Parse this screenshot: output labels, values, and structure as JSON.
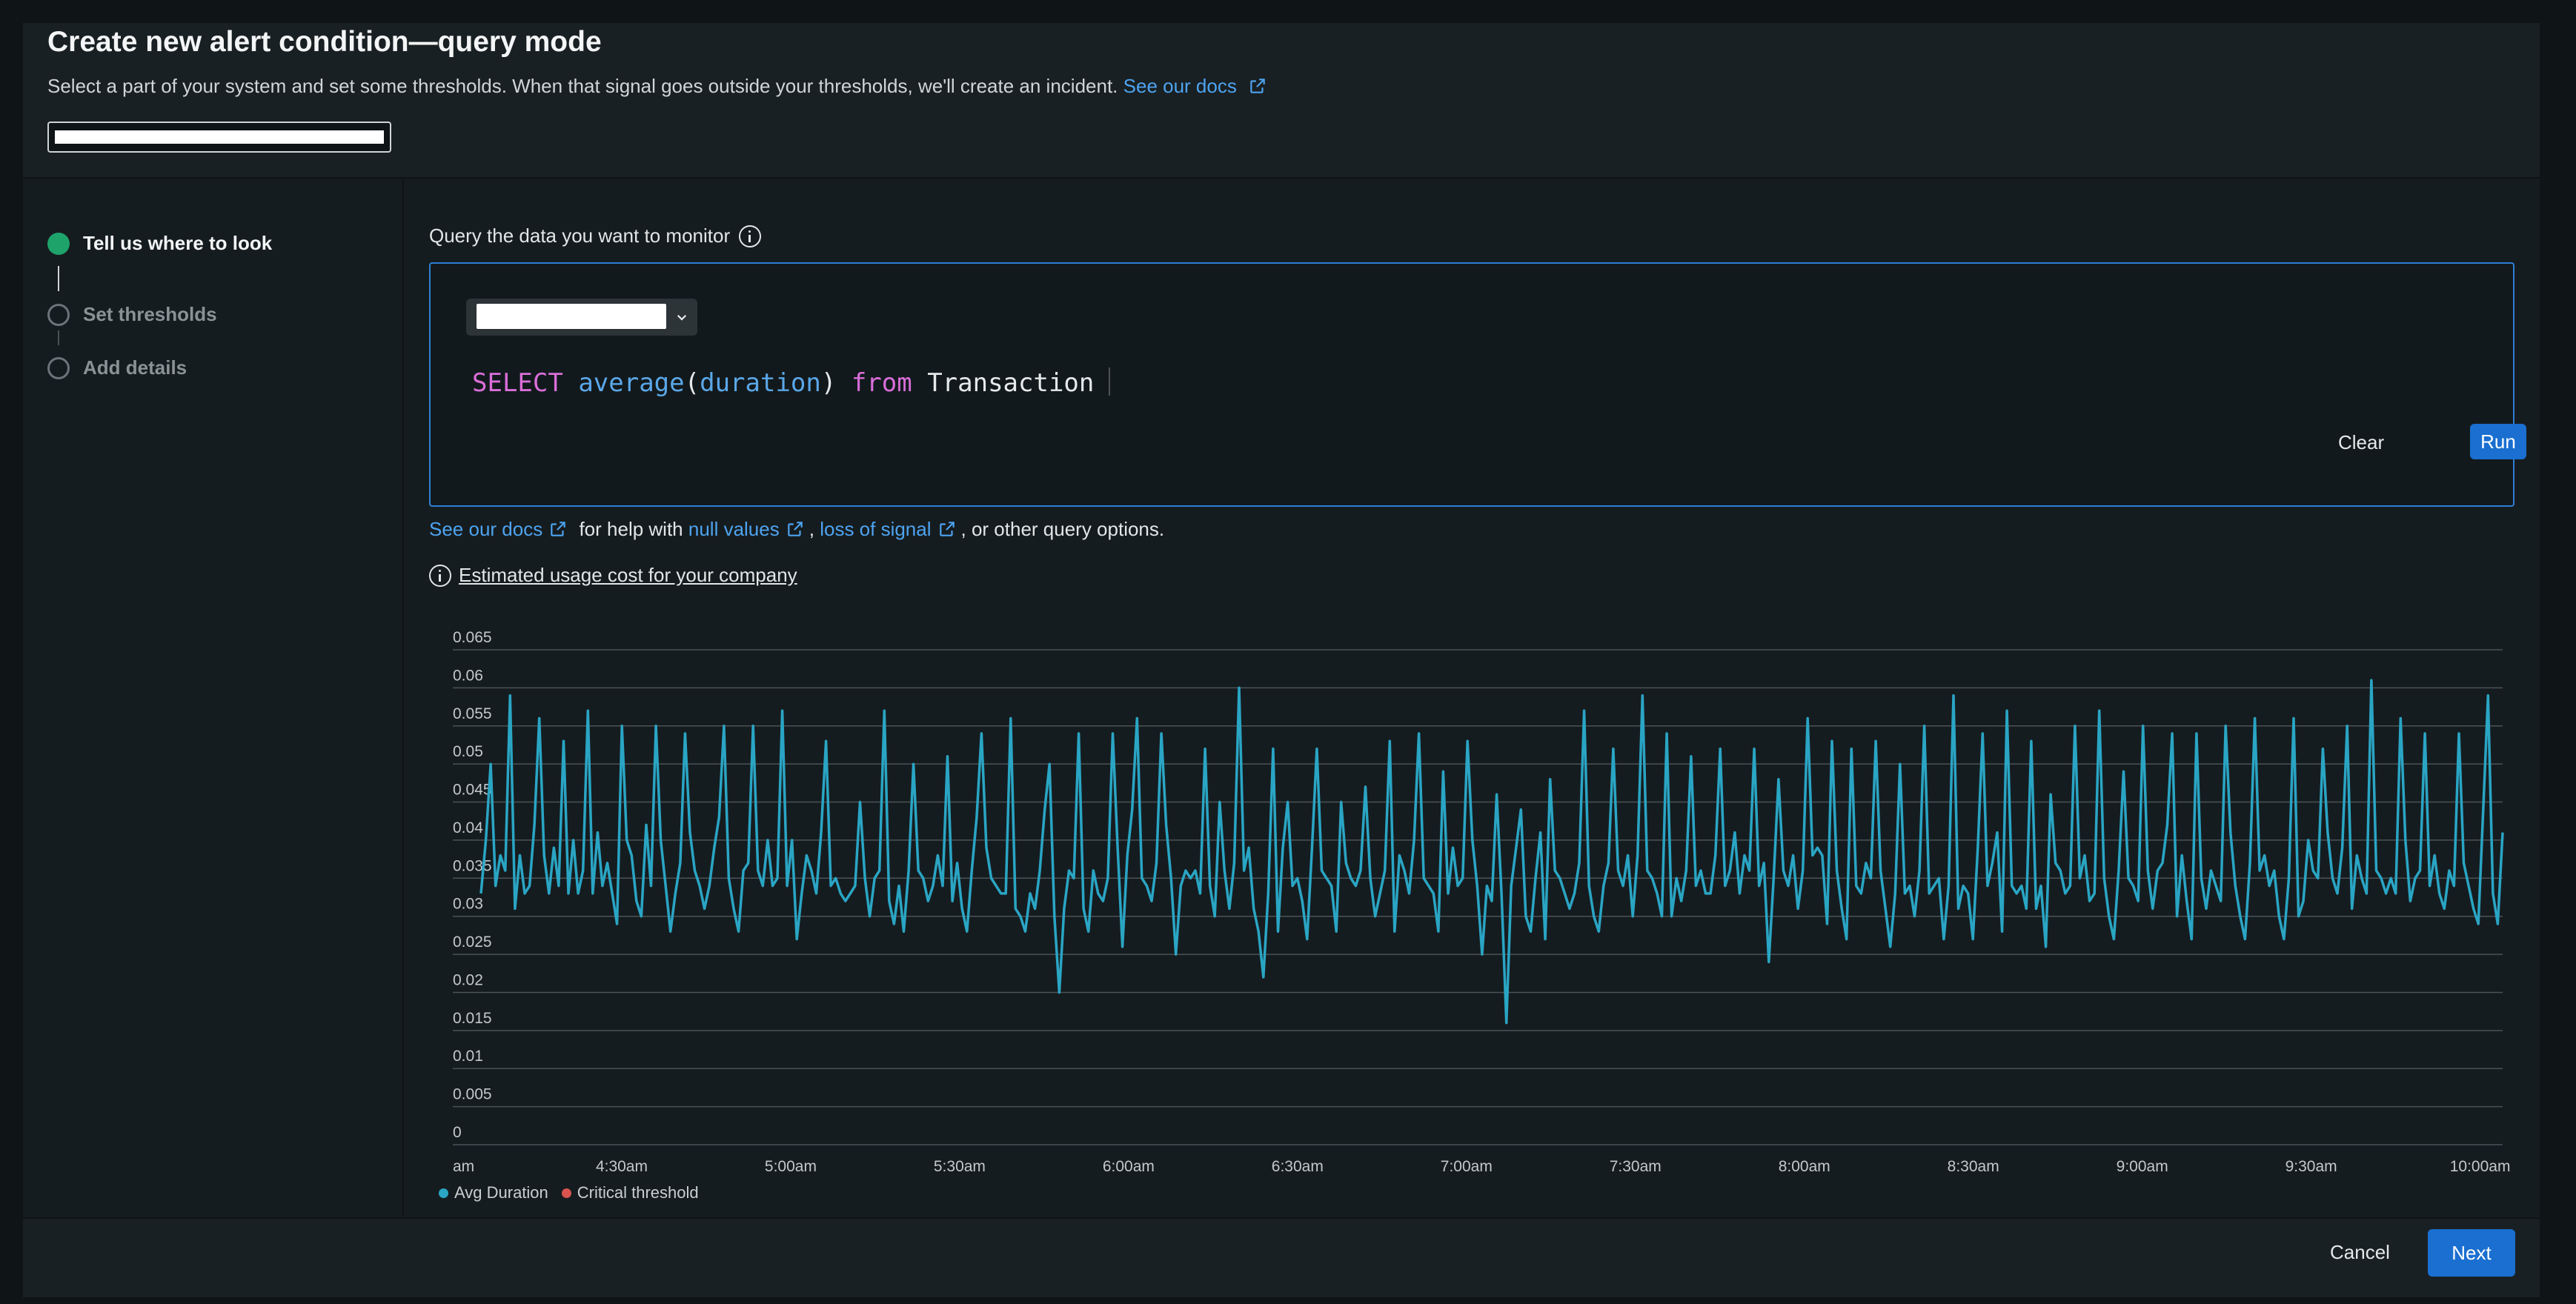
{
  "header": {
    "title": "Create new alert condition—query mode",
    "subtitle": "Select a part of your system and set some thresholds. When that signal goes outside your thresholds, we'll create an incident.",
    "docs_link": "See our docs"
  },
  "steps": [
    {
      "label": "Tell us where to look",
      "state": "done"
    },
    {
      "label": "Set thresholds",
      "state": "todo"
    },
    {
      "label": "Add details",
      "state": "todo"
    }
  ],
  "query": {
    "label": "Query the data you want to monitor",
    "tokens": {
      "select": "SELECT",
      "func": "average",
      "open": "(",
      "arg": "duration",
      "close": ")",
      "from": "from",
      "table": "Transaction"
    },
    "clear_label": "Clear",
    "run_label": "Run"
  },
  "help": {
    "docs": "See our docs",
    "mid1": "for help with",
    "null_values": "null values",
    "comma": ",",
    "loss_of_signal": "loss of signal",
    "tail": ", or other query options."
  },
  "estimate": {
    "label": "Estimated usage cost for your company"
  },
  "chart_data": {
    "type": "line",
    "y_ticks": [
      "0",
      "0.005",
      "0.01",
      "0.015",
      "0.02",
      "0.025",
      "0.03",
      "0.035",
      "0.04",
      "0.045",
      "0.05",
      "0.055",
      "0.06",
      "0.065"
    ],
    "ylim": [
      0,
      0.065
    ],
    "x_ticks": [
      "am",
      "4:30am",
      "5:00am",
      "5:30am",
      "6:00am",
      "6:30am",
      "7:00am",
      "7:30am",
      "8:00am",
      "8:30am",
      "9:00am",
      "9:30am",
      "10:00am"
    ],
    "xlim": [
      "4:00am",
      "10:04am"
    ],
    "grid": true,
    "legend_position": "bottom-left",
    "series": [
      {
        "name": "Avg Duration",
        "color": "#2aa5c4",
        "x_start": "4:05am",
        "x_step_minutes": 1,
        "values": [
          0.033,
          0.04,
          0.05,
          0.034,
          0.038,
          0.036,
          0.059,
          0.031,
          0.038,
          0.033,
          0.034,
          0.042,
          0.056,
          0.038,
          0.033,
          0.039,
          0.034,
          0.053,
          0.033,
          0.04,
          0.033,
          0.036,
          0.057,
          0.033,
          0.041,
          0.034,
          0.037,
          0.033,
          0.029,
          0.055,
          0.04,
          0.038,
          0.032,
          0.03,
          0.042,
          0.034,
          0.055,
          0.04,
          0.034,
          0.028,
          0.033,
          0.037,
          0.054,
          0.041,
          0.036,
          0.034,
          0.031,
          0.034,
          0.039,
          0.043,
          0.055,
          0.035,
          0.031,
          0.028,
          0.036,
          0.037,
          0.055,
          0.036,
          0.034,
          0.04,
          0.034,
          0.035,
          0.057,
          0.034,
          0.04,
          0.027,
          0.033,
          0.038,
          0.036,
          0.033,
          0.041,
          0.053,
          0.034,
          0.035,
          0.033,
          0.032,
          0.033,
          0.034,
          0.045,
          0.035,
          0.03,
          0.035,
          0.036,
          0.057,
          0.032,
          0.029,
          0.034,
          0.028,
          0.036,
          0.05,
          0.036,
          0.035,
          0.032,
          0.034,
          0.038,
          0.034,
          0.051,
          0.032,
          0.037,
          0.031,
          0.028,
          0.036,
          0.043,
          0.054,
          0.039,
          0.035,
          0.034,
          0.033,
          0.033,
          0.056,
          0.031,
          0.03,
          0.028,
          0.033,
          0.031,
          0.036,
          0.044,
          0.05,
          0.03,
          0.02,
          0.031,
          0.036,
          0.035,
          0.054,
          0.031,
          0.028,
          0.036,
          0.033,
          0.032,
          0.035,
          0.054,
          0.039,
          0.026,
          0.038,
          0.044,
          0.056,
          0.035,
          0.034,
          0.032,
          0.037,
          0.054,
          0.042,
          0.035,
          0.025,
          0.034,
          0.036,
          0.035,
          0.036,
          0.033,
          0.052,
          0.034,
          0.03,
          0.045,
          0.036,
          0.031,
          0.037,
          0.06,
          0.036,
          0.039,
          0.031,
          0.028,
          0.022,
          0.033,
          0.052,
          0.028,
          0.039,
          0.045,
          0.034,
          0.035,
          0.032,
          0.027,
          0.039,
          0.052,
          0.036,
          0.035,
          0.034,
          0.028,
          0.045,
          0.037,
          0.035,
          0.034,
          0.036,
          0.047,
          0.035,
          0.03,
          0.033,
          0.036,
          0.053,
          0.028,
          0.038,
          0.036,
          0.033,
          0.04,
          0.054,
          0.035,
          0.034,
          0.033,
          0.028,
          0.049,
          0.033,
          0.039,
          0.034,
          0.035,
          0.053,
          0.04,
          0.034,
          0.025,
          0.034,
          0.032,
          0.046,
          0.033,
          0.016,
          0.034,
          0.039,
          0.044,
          0.03,
          0.028,
          0.035,
          0.041,
          0.027,
          0.048,
          0.036,
          0.035,
          0.033,
          0.031,
          0.033,
          0.037,
          0.057,
          0.034,
          0.03,
          0.028,
          0.034,
          0.037,
          0.052,
          0.036,
          0.034,
          0.038,
          0.03,
          0.038,
          0.059,
          0.036,
          0.035,
          0.033,
          0.03,
          0.054,
          0.03,
          0.035,
          0.032,
          0.036,
          0.051,
          0.034,
          0.036,
          0.033,
          0.033,
          0.038,
          0.052,
          0.034,
          0.036,
          0.041,
          0.033,
          0.038,
          0.036,
          0.052,
          0.034,
          0.037,
          0.024,
          0.035,
          0.048,
          0.036,
          0.034,
          0.038,
          0.031,
          0.036,
          0.056,
          0.038,
          0.039,
          0.038,
          0.029,
          0.053,
          0.036,
          0.031,
          0.027,
          0.052,
          0.034,
          0.033,
          0.037,
          0.035,
          0.053,
          0.036,
          0.031,
          0.026,
          0.033,
          0.05,
          0.033,
          0.034,
          0.03,
          0.036,
          0.055,
          0.033,
          0.034,
          0.035,
          0.027,
          0.034,
          0.059,
          0.031,
          0.034,
          0.033,
          0.027,
          0.039,
          0.054,
          0.034,
          0.037,
          0.041,
          0.028,
          0.057,
          0.034,
          0.033,
          0.034,
          0.031,
          0.053,
          0.031,
          0.034,
          0.026,
          0.046,
          0.037,
          0.036,
          0.033,
          0.034,
          0.055,
          0.035,
          0.038,
          0.032,
          0.033,
          0.057,
          0.035,
          0.03,
          0.027,
          0.036,
          0.049,
          0.035,
          0.034,
          0.032,
          0.055,
          0.036,
          0.031,
          0.036,
          0.037,
          0.042,
          0.054,
          0.03,
          0.038,
          0.032,
          0.027,
          0.054,
          0.035,
          0.031,
          0.036,
          0.034,
          0.032,
          0.055,
          0.041,
          0.034,
          0.03,
          0.027,
          0.037,
          0.056,
          0.036,
          0.038,
          0.034,
          0.036,
          0.03,
          0.027,
          0.035,
          0.056,
          0.03,
          0.032,
          0.04,
          0.036,
          0.035,
          0.052,
          0.041,
          0.035,
          0.033,
          0.039,
          0.055,
          0.031,
          0.038,
          0.035,
          0.033,
          0.061,
          0.036,
          0.035,
          0.033,
          0.035,
          0.033,
          0.056,
          0.04,
          0.032,
          0.035,
          0.036,
          0.054,
          0.034,
          0.038,
          0.033,
          0.031,
          0.036,
          0.034,
          0.054,
          0.037,
          0.034,
          0.031,
          0.029,
          0.044,
          0.059,
          0.033,
          0.029,
          0.041
        ]
      },
      {
        "name": "Critical threshold",
        "color": "#d9534f",
        "values": []
      }
    ]
  },
  "footer": {
    "cancel_label": "Cancel",
    "next_label": "Next"
  }
}
